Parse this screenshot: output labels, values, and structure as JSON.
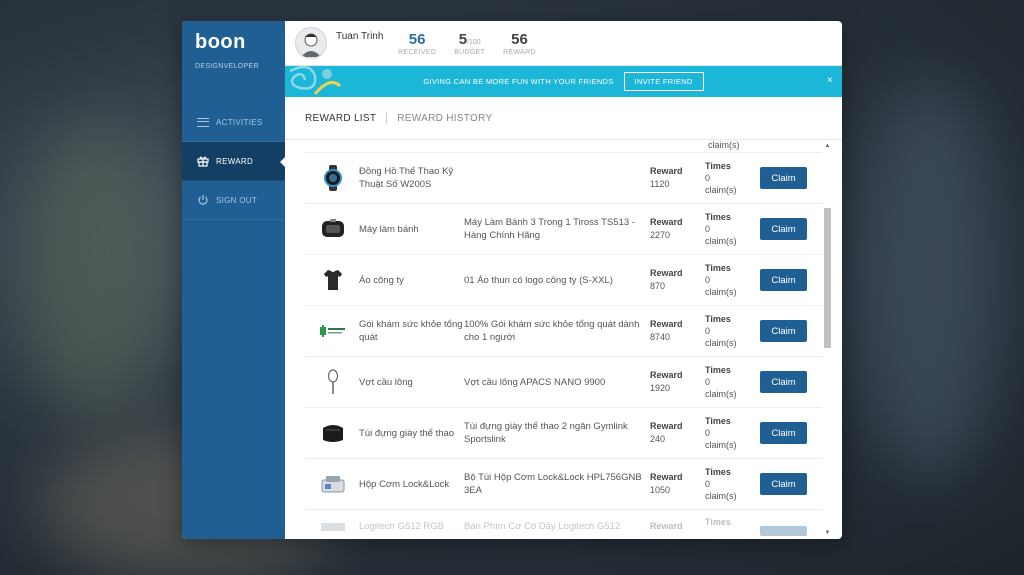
{
  "sidebar": {
    "logo": "boon",
    "logo_sub": "DESIGNVELOPER",
    "items": [
      {
        "label": "ACTIVITIES",
        "icon": "menu-icon"
      },
      {
        "label": "REWARD",
        "icon": "gift-icon"
      },
      {
        "label": "SIGN OUT",
        "icon": "power-icon"
      }
    ]
  },
  "header": {
    "user_name": "Tuan Trinh",
    "stats": [
      {
        "value": "56",
        "suffix": "",
        "label": "RECEIVED"
      },
      {
        "value": "5",
        "suffix": "/100",
        "label": "BUDGET"
      },
      {
        "value": "56",
        "suffix": "",
        "label": "REWARD"
      }
    ]
  },
  "banner": {
    "text": "GIVING CAN BE MORE FUN WITH YOUR FRIENDS",
    "button": "INVITE FRIEND",
    "close": "×"
  },
  "tabs": [
    {
      "label": "REWARD LIST",
      "active": true
    },
    {
      "label": "REWARD HISTORY",
      "active": false
    }
  ],
  "list": {
    "peek_times": "claim(s)",
    "claim_label": "Claim",
    "reward_label": "Reward",
    "times_label": "Times",
    "claims_suffix": "claim(s)",
    "items": [
      {
        "name": "Đồng Hồ Thể Thao Kỹ Thuật Số W200S",
        "desc": "",
        "reward": "1120",
        "times": "0",
        "icon": "watch-icon"
      },
      {
        "name": "Máy làm bánh",
        "desc": "Máy Làm Bánh 3 Trong 1 Tiross TS513 - Hàng Chính Hãng",
        "reward": "2270",
        "times": "0",
        "icon": "sandwich-maker-icon"
      },
      {
        "name": "Áo công ty",
        "desc": "01 Áo thun có logo công ty (S-XXL)",
        "reward": "870",
        "times": "0",
        "icon": "tshirt-icon"
      },
      {
        "name": "Gói khám sức khỏe tổng quát",
        "desc": "100% Gói khám sức khỏe tổng quát dành cho 1 người",
        "reward": "8740",
        "times": "0",
        "icon": "health-logo-icon"
      },
      {
        "name": "Vợt cầu lông",
        "desc": "Vợt cầu lông APACS NANO 9900",
        "reward": "1920",
        "times": "0",
        "icon": "racket-icon"
      },
      {
        "name": "Túi đựng giày thể thao",
        "desc": "Túi đựng giày thể thao 2 ngăn Gymlink Sportslink",
        "reward": "240",
        "times": "0",
        "icon": "shoe-bag-icon"
      },
      {
        "name": "Hộp Cơm Lock&Lock",
        "desc": "Bộ Túi Hộp Cơm Lock&Lock HPL756GNB 3EA",
        "reward": "1050",
        "times": "0",
        "icon": "lunchbox-icon"
      }
    ],
    "partial_item": {
      "name": "Logitech G512 RGB",
      "desc": "Bàn Phím Cơ Có Dây Logitech G512",
      "reward": "",
      "times": ""
    }
  }
}
